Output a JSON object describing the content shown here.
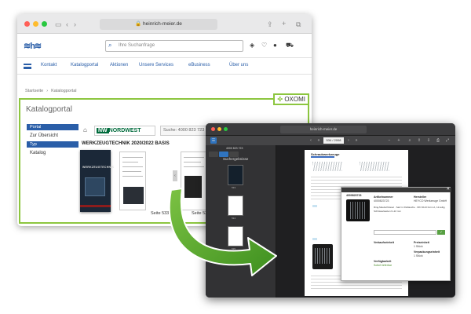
{
  "browser1": {
    "url": "heinrich-meier.de",
    "search_placeholder": "Ihre Suchanfrage",
    "logo_text": "≋h≋",
    "nav": [
      "Kontakt",
      "Katalogportal",
      "Aktionen",
      "Unsere Services",
      "eBusiness",
      "Über uns"
    ],
    "breadcrumb": [
      "Startseite",
      "Katalogportal"
    ],
    "oxomi_label": "OXOMI",
    "page_title": "Katalogportal",
    "sidebar": {
      "portal_header": "Portal",
      "portal_item": "Zur Übersicht",
      "type_header": "Typ",
      "type_item": "Katalog"
    },
    "toolbar": {
      "brand": "NORDWEST",
      "brand_mark": "NW",
      "search_text": "Suche: 4000 823 723"
    },
    "catalog_title": "WERKZEUGTECHNIK 2020/2022 BASIS",
    "cover_title": "WERKZEUGTECHNIK",
    "page_labels": [
      "Seite 533",
      "Seite 534"
    ]
  },
  "browser2": {
    "url": "heinrich-meier.de",
    "page_field": "534 / 2008",
    "sidebar_title": "Suchergebnisse",
    "search_chip": "4000 823 723",
    "thumb_labels": [
      "533",
      "534",
      "535"
    ],
    "doc_heading": "Schraubwerkzeuge",
    "popup": {
      "article_no": "4000823723",
      "article_label": "Artikelnummer",
      "article_value": "4000823723",
      "maker_label": "Hersteller",
      "maker_value": "HEYCO Werkzeuge GmbH",
      "description": "Ring-Maulschlüssel · Satz in Rolltasche · DIN 3113 Form A, 12-teilig, Schlüsselweiten 6–22 mm",
      "stock_label": "Verkaufseinheit",
      "price_label": "Preiseinheit",
      "price_value": "1 Stück",
      "package_label": "Verpackungseinheit",
      "package_value": "1 Stück",
      "availability_label": "Verfügbarkeit",
      "availability_value": "Sofort lieferbar",
      "cart_label": "✓"
    }
  },
  "colors": {
    "brand_blue": "#2a5ea8",
    "oxomi_green": "#8cc63f",
    "arrow_green": "#5aa82b",
    "nordwest_green": "#006b3c"
  }
}
